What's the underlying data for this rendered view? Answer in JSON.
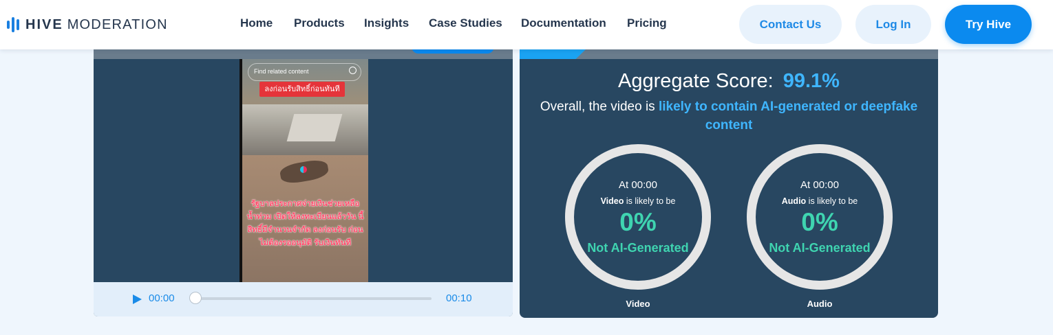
{
  "brand": {
    "name_bold": "HIVE",
    "name_rest": "MODERATION",
    "accent": "#1a7fe0"
  },
  "nav": {
    "home": "Home",
    "products": "Products",
    "insights": "Insights",
    "case_studies": "Case Studies",
    "documentation": "Documentation",
    "pricing": "Pricing"
  },
  "actions": {
    "contact": "Contact Us",
    "login": "Log In",
    "try": "Try Hive"
  },
  "video": {
    "search_placeholder": "Find related content",
    "banner_text": "ลงก่อนรับสิทธิ์ก่อนทันที",
    "caption": "รัฐบาลประกาศจ่ายเงินช่วยเหลือ น้ำท่วม เปิดให้ลงทะเบียนแล้ววัน นี้สิทธิ์มีจำนวนจำกัด ลงก่อนรับ ก่อนไม่ต้องรออนุมัติ รับเงินทันที",
    "time_current": "00:00",
    "time_total": "00:10",
    "progress": 0
  },
  "results": {
    "aggregate_label": "Aggregate Score:",
    "aggregate_value": "99.1%",
    "overall_prefix": "Overall, the video is",
    "overall_verdict": "likely to contain AI-generated or deepfake content",
    "gauges": [
      {
        "at": "At 00:00",
        "subject": "Video",
        "likely": "is likely to be",
        "percent": "0%",
        "label": "Not AI-Generated",
        "caption": "Video"
      },
      {
        "at": "At 00:00",
        "subject": "Audio",
        "likely": "is likely to be",
        "percent": "0%",
        "label": "Not AI-Generated",
        "caption": "Audio"
      }
    ]
  },
  "colors": {
    "panel": "#284761",
    "accent_blue": "#3fb6ff",
    "accent_green": "#3fd4b0",
    "primary_button": "#0b8aef"
  }
}
